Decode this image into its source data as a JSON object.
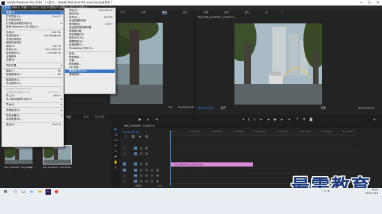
{
  "title_bar": {
    "title": "Adobe Premiere Pro 2020 - C:\\用户\\...\\Adobe Premiere Pro Auto-Save\\未命名 *",
    "minimize": "—",
    "maximize": "▢",
    "close": "✕"
  },
  "menu_bar": [
    "文件(F)",
    "编辑(E)",
    "剪辑(C)",
    "序列(S)",
    "标记(M)",
    "图形(G)",
    "视图(V)",
    "窗口(W)",
    "帮助(H)"
  ],
  "workspace_tabs": [
    "学习",
    "组件",
    "编辑",
    "颜色",
    "效果",
    "音频",
    "图形",
    "库"
  ],
  "workspace_more": "»",
  "program_monitor": {
    "title": "节目: IMG_20200907_150457 ≡",
    "timecode": "00;00;00;00",
    "fit": "适合",
    "quality": "完整",
    "duration": "00;00;05;00"
  },
  "source_monitor": {
    "page": "1/2",
    "duration": "00;00;00;00"
  },
  "transport_icons": [
    "marker-icon",
    "in-point-icon",
    "out-point-icon",
    "go-to-in-icon",
    "step-back-icon",
    "play-icon",
    "step-forward-icon",
    "go-to-out-icon",
    "lift-icon",
    "extract-icon",
    "export-frame-icon",
    "add-icon"
  ],
  "project_panel": {
    "tabs": [
      "项目: 未命名",
      "媒体浏览器",
      "库",
      "信息",
      "效果",
      "标记",
      "历史记录"
    ],
    "items": [
      {
        "name": "IMG_20200907_1504S7.jpg",
        "duration": "5;00"
      },
      {
        "name": "IMG_20200907_150457",
        "duration": "5;00"
      }
    ]
  },
  "timeline": {
    "sequence_tab": "IMG_20200907_150457 ≡",
    "timecode": "00;00;00;00",
    "ruler_ticks": [
      "00;00",
      "00;00;02;00",
      "00;00;04;00",
      "00;00;06;00",
      "00;00;08;00",
      "00;00;10;00",
      "00;00;12;00",
      "00;00;14;00",
      "00;00;16;00"
    ],
    "tracks": [
      {
        "id": "V3"
      },
      {
        "id": "V2"
      },
      {
        "id": "V1"
      },
      {
        "id": "A1"
      },
      {
        "id": "A2"
      },
      {
        "id": "A3"
      }
    ],
    "master": "主声道",
    "master_value": "0.0",
    "clip": "IMG_20200907_150457.jpg"
  },
  "file_menu": [
    {
      "label": "新建(N)",
      "submenu": true,
      "highlight": true
    },
    {
      "label": "打开项目(O)...",
      "shortcut": "Ctrl+O"
    },
    {
      "label": "打开团队项目...",
      "shortcut": ""
    },
    {
      "label": "打开最近使用的内容(E)",
      "submenu": true
    },
    {
      "label": "转换 Premiere Clip 项目(C)...",
      "shortcut": ""
    },
    {
      "sep": true
    },
    {
      "label": "关闭(C)",
      "shortcut": "Ctrl+W"
    },
    {
      "label": "关闭项目(P)",
      "shortcut": "Ctrl+Shift+W"
    },
    {
      "label": "关闭所有项目",
      "shortcut": ""
    },
    {
      "label": "刷新所有项目",
      "shortcut": ""
    },
    {
      "label": "保存(S)",
      "shortcut": "Ctrl+S"
    },
    {
      "label": "另存为(A)...",
      "shortcut": "Ctrl+Shift+S"
    },
    {
      "label": "保存副本(Y)...",
      "shortcut": "Ctrl+Alt+S"
    },
    {
      "label": "全部保存",
      "shortcut": ""
    },
    {
      "label": "还原(R)",
      "shortcut": ""
    },
    {
      "sep": true
    },
    {
      "label": "同步设置",
      "submenu": true
    },
    {
      "sep": true
    },
    {
      "label": "捕捉(T)...",
      "shortcut": "F5"
    },
    {
      "label": "批量捕捉(B)...",
      "shortcut": "F6"
    },
    {
      "sep": true
    },
    {
      "label": "链接媒体(L)...",
      "shortcut": ""
    },
    {
      "label": "设为脱机(O)...",
      "shortcut": ""
    },
    {
      "sep": true
    },
    {
      "label": "Adobe Dynamic Link",
      "submenu": true,
      "disabled": true
    },
    {
      "label": "从媒体浏览器导入(M)",
      "shortcut": "Ctrl+Alt+I",
      "disabled": true
    },
    {
      "label": "导入(I)...",
      "shortcut": "Ctrl+I"
    },
    {
      "label": "导入最近使用的文件(F)",
      "submenu": true
    },
    {
      "sep": true
    },
    {
      "label": "导出(E)",
      "submenu": true
    },
    {
      "sep": true
    },
    {
      "label": "获取属性(G)",
      "submenu": true
    },
    {
      "sep": true
    },
    {
      "label": "项目设置(P)",
      "submenu": true
    },
    {
      "label": "项目管理(M)...",
      "shortcut": ""
    },
    {
      "sep": true
    },
    {
      "label": "退出(X)",
      "shortcut": "Ctrl+Q"
    }
  ],
  "new_submenu": [
    {
      "label": "项目(P)...",
      "shortcut": "Ctrl+Alt+N"
    },
    {
      "label": "团队项目...",
      "shortcut": ""
    },
    {
      "label": "序列(S)...",
      "shortcut": "Ctrl+N"
    },
    {
      "label": "来自剪辑的序列",
      "shortcut": ""
    },
    {
      "label": "素材箱(B)",
      "shortcut": "Ctrl+/"
    },
    {
      "label": "来自选择项的素材箱",
      "shortcut": ""
    },
    {
      "label": "搜索素材箱",
      "shortcut": ""
    },
    {
      "label": "项目快捷方式",
      "shortcut": ""
    },
    {
      "label": "脱机文件(O)...",
      "shortcut": ""
    },
    {
      "label": "调整图层(A)...",
      "shortcut": ""
    },
    {
      "label": "旧版标题(T)...",
      "shortcut": ""
    },
    {
      "label": "Photoshop 文件(H)...",
      "shortcut": ""
    },
    {
      "sep": true
    },
    {
      "label": "彩条...",
      "shortcut": ""
    },
    {
      "label": "黑场视频...",
      "shortcut": ""
    },
    {
      "label": "字幕...",
      "shortcut": ""
    },
    {
      "label": "颜色遮罩...",
      "shortcut": ""
    },
    {
      "label": "HD 彩条...",
      "shortcut": ""
    },
    {
      "label": "通用倒计时片头...",
      "shortcut": "",
      "highlight": true
    },
    {
      "label": "透明视频...",
      "shortcut": ""
    }
  ],
  "watermark": "最需教育",
  "taskbar": {
    "icons": [
      "windows-icon",
      "search-icon",
      "task-view-icon",
      "edge-icon",
      "explorer-icon",
      "premiere-icon",
      "other-app-icon"
    ],
    "premiere_label": "Pr",
    "time": "9:22",
    "date": "2021/7/19",
    "tray": "^ ㅁ 中"
  },
  "colors": {
    "accent": "#4a8fff",
    "clip": "#d98bd3",
    "menu_highlight": "#3e78c4",
    "watermark": "#1a3a7a"
  }
}
